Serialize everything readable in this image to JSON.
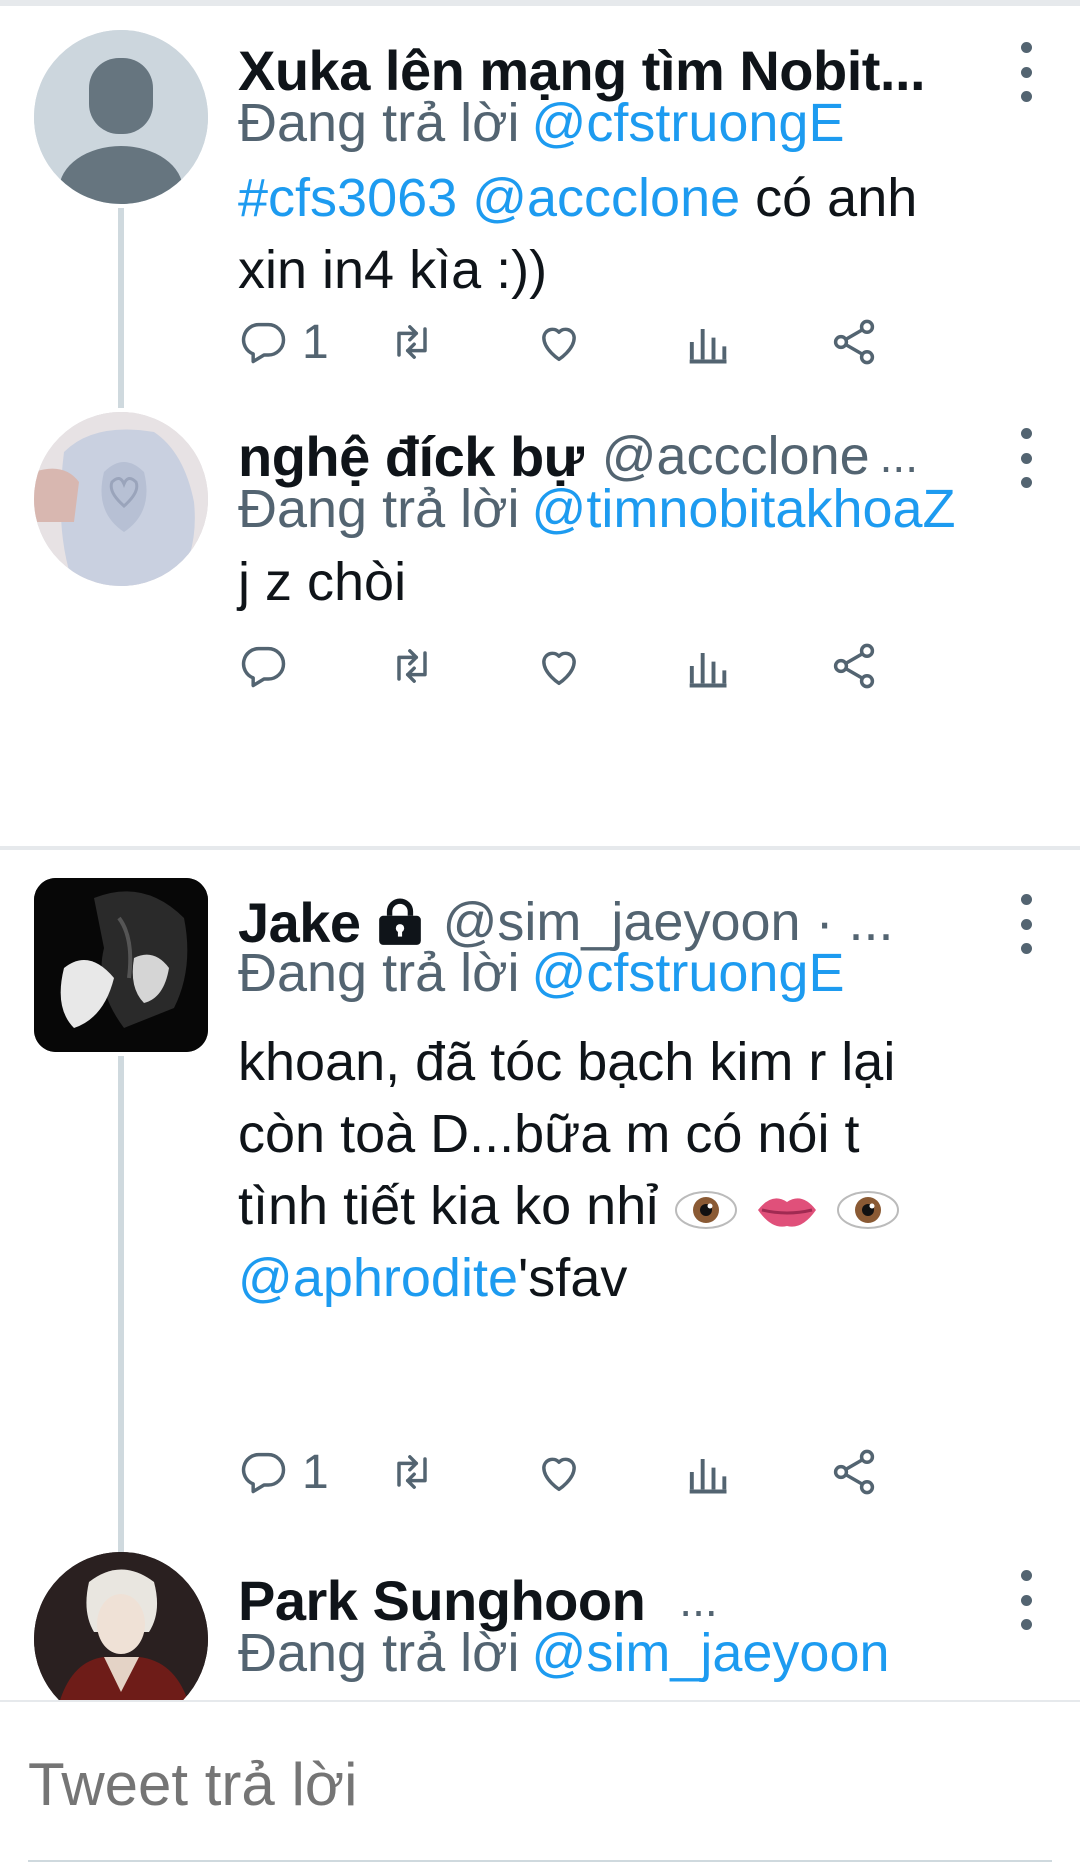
{
  "tweets": [
    {
      "display_name": "Xuka lên mạng tìm Nobit...",
      "replying_label": "Đang trả lời",
      "replying_to": "@cfstruongE",
      "body": {
        "hashtag": "#cfs3063",
        "mention": "@accclone",
        "line1_rest": " có anh",
        "line2": "xin in4 kìa :))"
      },
      "reply_count": "1",
      "avatar": "default-person-icon"
    },
    {
      "display_name": "nghệ đíck bự",
      "handle": "@accclone",
      "ellipsis": "...",
      "replying_label": "Đang trả lời",
      "replying_to": "@timnobitakhoaZ",
      "body_text": "j z chòi",
      "reply_count": "",
      "avatar": "photo"
    },
    {
      "display_name": "Jake",
      "handle": "@sim_jaeyoon · ...",
      "replying_label": "Đang trả lời",
      "replying_to": "@cfstruongE",
      "body": {
        "line1": "khoan, đã tóc bạch kim r lại",
        "line2": "còn toà D...bữa m có nói t",
        "line3": "tình tiết kia ko nhỉ",
        "mention": "@aphrodite",
        "mention_suffix": "'sfav"
      },
      "reply_count": "1",
      "avatar": "photo",
      "badge": "lock-icon"
    },
    {
      "display_name": "Park Sunghoon",
      "ellipsis": "...",
      "replying_label": "Đang trả lời",
      "replying_to": "@sim_jaeyoon",
      "avatar": "photo"
    }
  ],
  "composer": {
    "placeholder": "Tweet trả lời"
  },
  "colors": {
    "link": "#1d9bf0",
    "secondary": "#536471",
    "divider": "#e6e9ec"
  },
  "icons": [
    "reply-icon",
    "retweet-icon",
    "like-icon",
    "analytics-icon",
    "share-icon",
    "more-icon"
  ]
}
